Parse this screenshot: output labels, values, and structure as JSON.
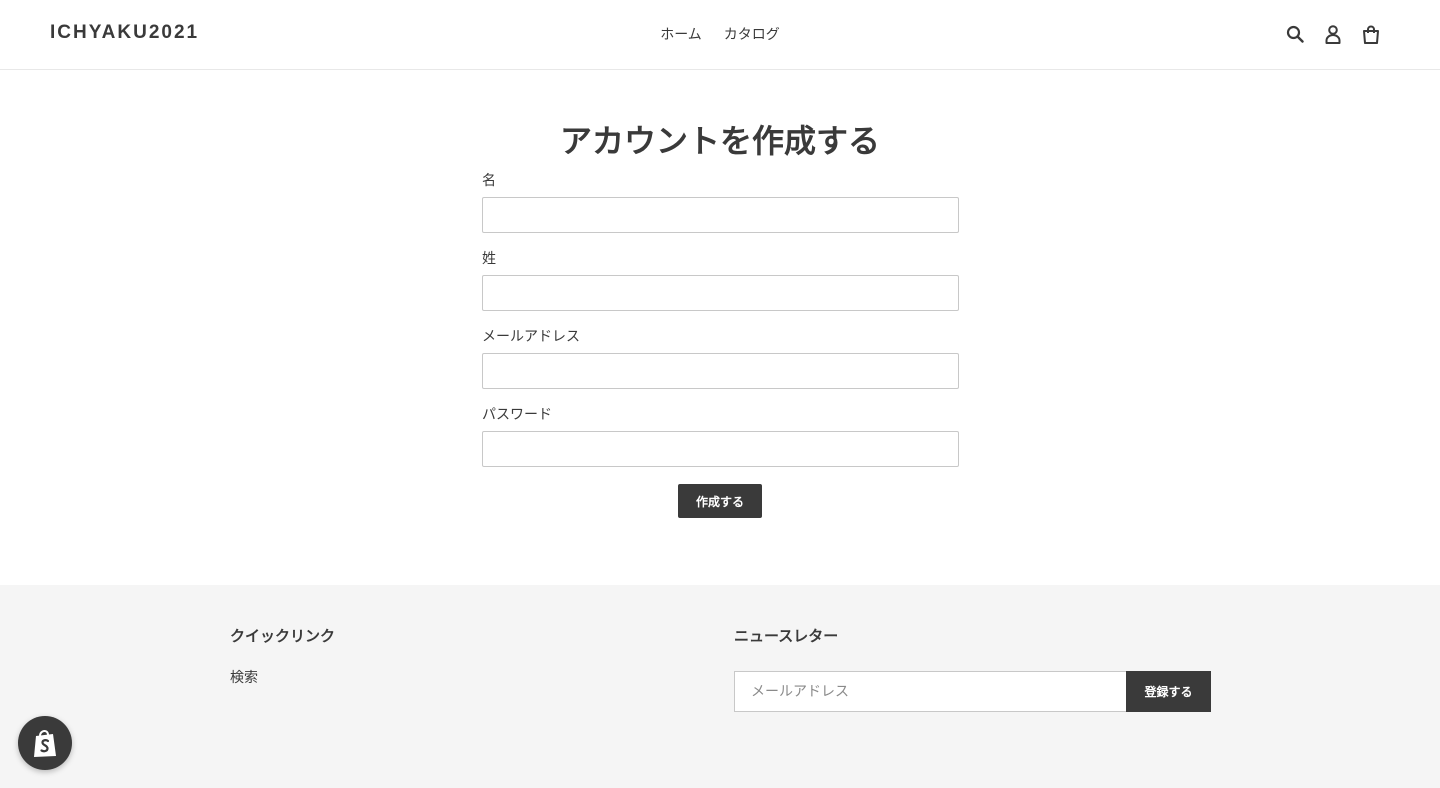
{
  "header": {
    "logo": "ICHYAKU2021",
    "nav": [
      {
        "label": "ホーム"
      },
      {
        "label": "カタログ"
      }
    ],
    "icons": [
      "search-icon",
      "account-icon",
      "cart-icon"
    ]
  },
  "main": {
    "title": "アカウントを作成する",
    "fields": [
      {
        "label": "名",
        "value": ""
      },
      {
        "label": "姓",
        "value": ""
      },
      {
        "label": "メールアドレス",
        "value": ""
      },
      {
        "label": "パスワード",
        "value": ""
      }
    ],
    "submit_label": "作成する"
  },
  "footer": {
    "quick_links_heading": "クイックリンク",
    "quick_links": [
      {
        "label": "検索"
      }
    ],
    "newsletter_heading": "ニュースレター",
    "newsletter_placeholder": "メールアドレス",
    "newsletter_button": "登録する"
  },
  "badge": {
    "icon": "shopify-bag-icon"
  },
  "colors": {
    "text": "#3a3a3a",
    "button": "#3a3a3a",
    "footer_bg": "#f5f5f5",
    "border": "#c8c8c8"
  }
}
